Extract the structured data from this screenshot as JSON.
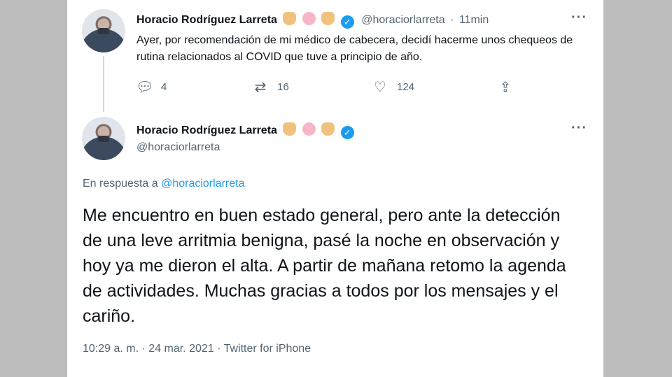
{
  "tweet1": {
    "name": "Horacio Rodríguez Larreta",
    "handle": "@horaciorlarreta",
    "time_sep": "·",
    "time": "11min",
    "text": "Ayer, por recomendación de mi médico de cabecera, decidí hacerme unos chequeos de rutina relacionados al COVID que tuve a principio de año.",
    "replies": "4",
    "retweets": "16",
    "likes": "124"
  },
  "tweet2": {
    "name": "Horacio Rodríguez Larreta",
    "handle": "@horaciorlarreta",
    "reply_prefix": "En respuesta a",
    "reply_handle": "@horaciorlarreta",
    "text": "Me encuentro en buen estado general, pero ante la detección de una leve arritmia benigna, pasé la noche en observación y hoy ya me dieron el alta. A partir de mañana retomo la agenda de actividades. Muchas gracias a todos por los mensajes y el cariño.",
    "timestamp": "10:29 a. m. · 24 mar. 2021 · Twitter for iPhone"
  },
  "icons": [
    "raised-hand-icon",
    "pill-icon",
    "raised-hand-icon",
    "verified-badge-icon",
    "more-icon",
    "reply-icon",
    "retweet-icon",
    "like-icon",
    "share-icon"
  ],
  "colors": {
    "accent": "#1d9bf0",
    "text": "#0f1419",
    "muted": "#536471",
    "backdrop": "#bdbdbd"
  }
}
